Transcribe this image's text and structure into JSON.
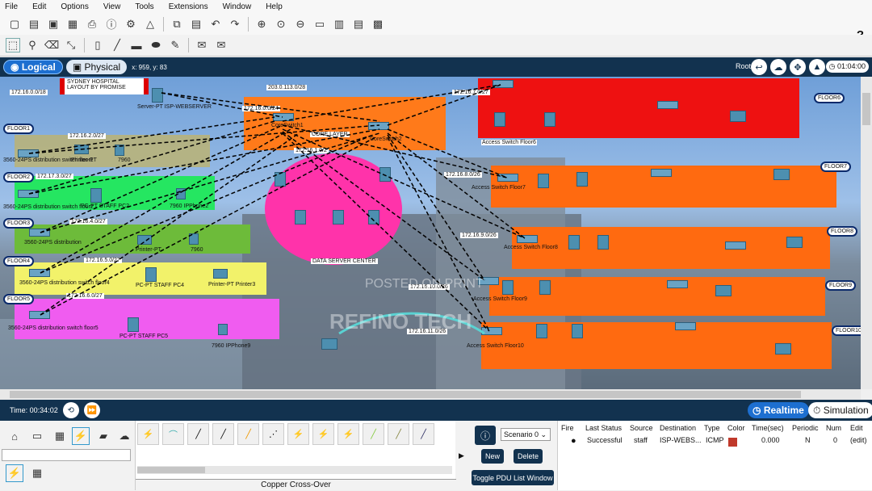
{
  "menu": [
    "File",
    "Edit",
    "Options",
    "View",
    "Tools",
    "Extensions",
    "Window",
    "Help"
  ],
  "nav": {
    "logical": "Logical",
    "physical": "Physical",
    "coords": "x: 959, y: 83",
    "root": "Root",
    "time": "01:04:00"
  },
  "canvas": {
    "title": "SYDNEY HOSPITAL LAYOUT BY PROMISE",
    "floors": [
      "FLOOR1",
      "FLOOR2",
      "FLOOR3",
      "FLOOR4",
      "FLOOR5",
      "FLOOR6",
      "FLOOR7",
      "FLOOR8",
      "FLOOR9",
      "FLOOR10"
    ],
    "left_devices": [
      {
        "switch": "3560-24PS distribution switch floor1",
        "dev1": "Printer-PT",
        "dev2": "7960"
      },
      {
        "switch": "3560-24PS distribution switch floor2",
        "dev1": "PC-PT STAFF PC2",
        "dev2": "7960 IPPhone2"
      },
      {
        "switch": "3560-24PS distribution",
        "dev1": "Printer-PT",
        "dev2": "7960"
      },
      {
        "switch": "3560-24PS distribution switch floor4",
        "dev1": "PC-PT STAFF PC4",
        "dev2": "Printer-PT Printer3"
      },
      {
        "switch": "3560-24PS distribution switch floor5",
        "dev1": "PC-PT STAFF PC5",
        "dev2": "7960 IPPhone9"
      }
    ],
    "networks": [
      "172.16.0.0/18",
      "172.16.2.0/27",
      "172.17.3.0/27",
      "172.16.4.0/27",
      "172.16.5.0/27",
      "172.16.6.0/27",
      "203.0.113.0/28",
      "172.16.0.0/24",
      "172.16.1.0/2",
      "172.16.7.0/27",
      "172.16.8.0/26",
      "172.16.9.0/26",
      "172.16.10.0/26",
      "172.16.11.0/26"
    ],
    "core_label": "CORE LAYER",
    "core_switches": [
      "CoreSwitch1",
      "CoreSwitch2"
    ],
    "isp": "Server-PT ISP-WEBSERVER",
    "dc_label": "DATA SERVER CENTER",
    "right_switches": [
      "Access Switch Floor6",
      "Access Switch Floor7",
      "Access Switch Floor8",
      "Access Switch Floor9",
      "Access Switch Floor10"
    ],
    "watermark1": "POSTED ON PRINT",
    "watermark2": "REFINO TECH"
  },
  "timebar": {
    "time": "Time: 00:34:02",
    "realtime": "Realtime",
    "simulation": "Simulation"
  },
  "cable_name": "Copper Cross-Over",
  "scenario": {
    "select": "Scenario 0",
    "new": "New",
    "delete": "Delete",
    "toggle": "Toggle PDU List Window"
  },
  "pdu": {
    "headers": [
      "Fire",
      "Last Status",
      "Source",
      "Destination",
      "Type",
      "Color",
      "Time(sec)",
      "Periodic",
      "Num",
      "Edit"
    ],
    "row": {
      "status": "Successful",
      "source": "staff",
      "dest": "ISP-WEBS...",
      "type": "ICMP",
      "color": "#c0392b",
      "time": "0.000",
      "periodic": "N",
      "num": "0",
      "edit": "(edit)"
    }
  }
}
